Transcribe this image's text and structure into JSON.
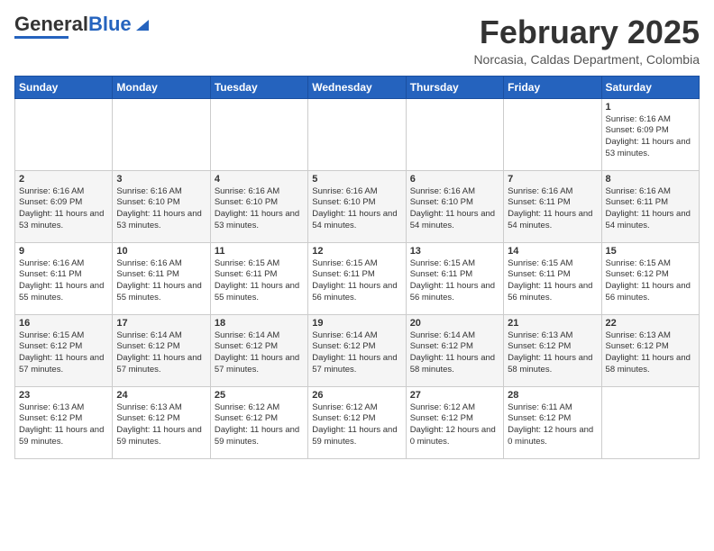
{
  "header": {
    "logo_general": "General",
    "logo_blue": "Blue",
    "month_title": "February 2025",
    "location": "Norcasia, Caldas Department, Colombia"
  },
  "weekdays": [
    "Sunday",
    "Monday",
    "Tuesday",
    "Wednesday",
    "Thursday",
    "Friday",
    "Saturday"
  ],
  "weeks": [
    [
      {
        "day": "",
        "info": ""
      },
      {
        "day": "",
        "info": ""
      },
      {
        "day": "",
        "info": ""
      },
      {
        "day": "",
        "info": ""
      },
      {
        "day": "",
        "info": ""
      },
      {
        "day": "",
        "info": ""
      },
      {
        "day": "1",
        "info": "Sunrise: 6:16 AM\nSunset: 6:09 PM\nDaylight: 11 hours and 53 minutes."
      }
    ],
    [
      {
        "day": "2",
        "info": "Sunrise: 6:16 AM\nSunset: 6:09 PM\nDaylight: 11 hours and 53 minutes."
      },
      {
        "day": "3",
        "info": "Sunrise: 6:16 AM\nSunset: 6:10 PM\nDaylight: 11 hours and 53 minutes."
      },
      {
        "day": "4",
        "info": "Sunrise: 6:16 AM\nSunset: 6:10 PM\nDaylight: 11 hours and 53 minutes."
      },
      {
        "day": "5",
        "info": "Sunrise: 6:16 AM\nSunset: 6:10 PM\nDaylight: 11 hours and 54 minutes."
      },
      {
        "day": "6",
        "info": "Sunrise: 6:16 AM\nSunset: 6:10 PM\nDaylight: 11 hours and 54 minutes."
      },
      {
        "day": "7",
        "info": "Sunrise: 6:16 AM\nSunset: 6:11 PM\nDaylight: 11 hours and 54 minutes."
      },
      {
        "day": "8",
        "info": "Sunrise: 6:16 AM\nSunset: 6:11 PM\nDaylight: 11 hours and 54 minutes."
      }
    ],
    [
      {
        "day": "9",
        "info": "Sunrise: 6:16 AM\nSunset: 6:11 PM\nDaylight: 11 hours and 55 minutes."
      },
      {
        "day": "10",
        "info": "Sunrise: 6:16 AM\nSunset: 6:11 PM\nDaylight: 11 hours and 55 minutes."
      },
      {
        "day": "11",
        "info": "Sunrise: 6:15 AM\nSunset: 6:11 PM\nDaylight: 11 hours and 55 minutes."
      },
      {
        "day": "12",
        "info": "Sunrise: 6:15 AM\nSunset: 6:11 PM\nDaylight: 11 hours and 56 minutes."
      },
      {
        "day": "13",
        "info": "Sunrise: 6:15 AM\nSunset: 6:11 PM\nDaylight: 11 hours and 56 minutes."
      },
      {
        "day": "14",
        "info": "Sunrise: 6:15 AM\nSunset: 6:11 PM\nDaylight: 11 hours and 56 minutes."
      },
      {
        "day": "15",
        "info": "Sunrise: 6:15 AM\nSunset: 6:12 PM\nDaylight: 11 hours and 56 minutes."
      }
    ],
    [
      {
        "day": "16",
        "info": "Sunrise: 6:15 AM\nSunset: 6:12 PM\nDaylight: 11 hours and 57 minutes."
      },
      {
        "day": "17",
        "info": "Sunrise: 6:14 AM\nSunset: 6:12 PM\nDaylight: 11 hours and 57 minutes."
      },
      {
        "day": "18",
        "info": "Sunrise: 6:14 AM\nSunset: 6:12 PM\nDaylight: 11 hours and 57 minutes."
      },
      {
        "day": "19",
        "info": "Sunrise: 6:14 AM\nSunset: 6:12 PM\nDaylight: 11 hours and 57 minutes."
      },
      {
        "day": "20",
        "info": "Sunrise: 6:14 AM\nSunset: 6:12 PM\nDaylight: 11 hours and 58 minutes."
      },
      {
        "day": "21",
        "info": "Sunrise: 6:13 AM\nSunset: 6:12 PM\nDaylight: 11 hours and 58 minutes."
      },
      {
        "day": "22",
        "info": "Sunrise: 6:13 AM\nSunset: 6:12 PM\nDaylight: 11 hours and 58 minutes."
      }
    ],
    [
      {
        "day": "23",
        "info": "Sunrise: 6:13 AM\nSunset: 6:12 PM\nDaylight: 11 hours and 59 minutes."
      },
      {
        "day": "24",
        "info": "Sunrise: 6:13 AM\nSunset: 6:12 PM\nDaylight: 11 hours and 59 minutes."
      },
      {
        "day": "25",
        "info": "Sunrise: 6:12 AM\nSunset: 6:12 PM\nDaylight: 11 hours and 59 minutes."
      },
      {
        "day": "26",
        "info": "Sunrise: 6:12 AM\nSunset: 6:12 PM\nDaylight: 11 hours and 59 minutes."
      },
      {
        "day": "27",
        "info": "Sunrise: 6:12 AM\nSunset: 6:12 PM\nDaylight: 12 hours and 0 minutes."
      },
      {
        "day": "28",
        "info": "Sunrise: 6:11 AM\nSunset: 6:12 PM\nDaylight: 12 hours and 0 minutes."
      },
      {
        "day": "",
        "info": ""
      }
    ]
  ]
}
